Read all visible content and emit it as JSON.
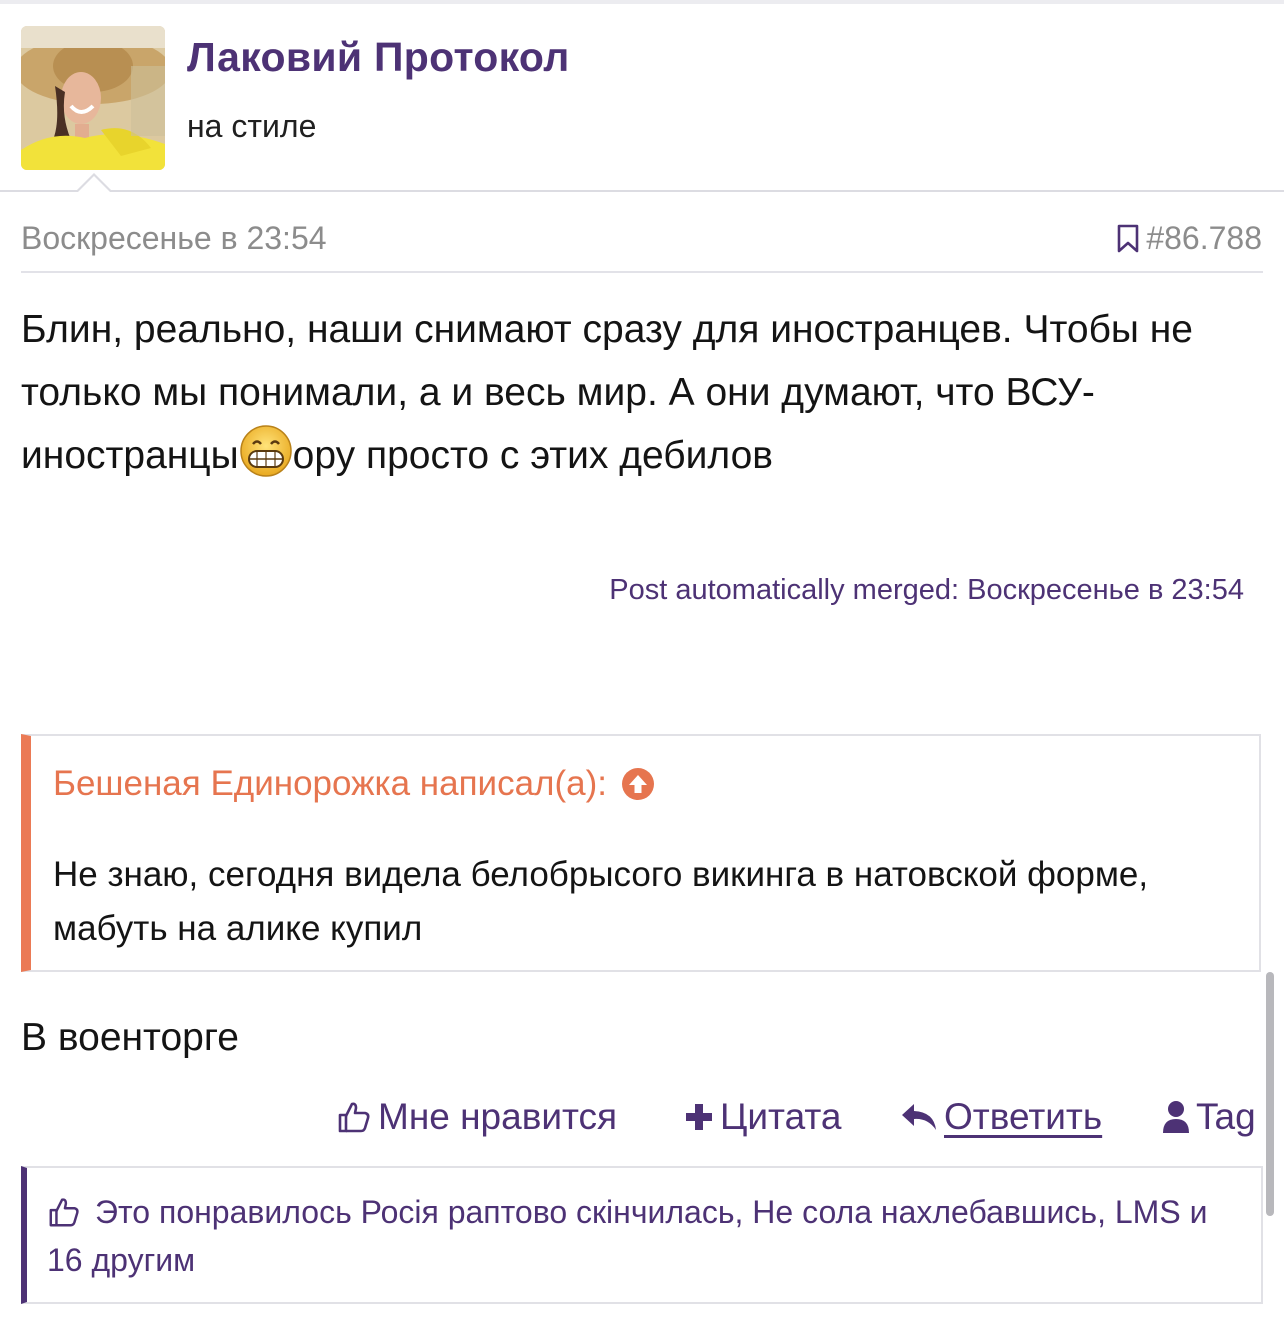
{
  "user": {
    "name": "Лаковий Протокол",
    "title": "на стиле"
  },
  "message": {
    "date": "Воскресенье в 23:54",
    "number": "#86.788",
    "body_part1": "Блин, реально, наши снимают сразу для иностранцев. Чтобы не только мы понимали, а и весь мир. А они думают, что ВСУ-иностранцы",
    "body_part2": "ору просто с этих дебилов",
    "merged_note": "Post automatically merged: Воскресенье в 23:54",
    "reply": "В военторге"
  },
  "quote": {
    "author": "Бешеная Единорожка написал(а):",
    "text": "Не знаю, сегодня видела белобрысого викинга в натовской форме, мабуть на алике купил"
  },
  "actions": {
    "like": "Мне нравится",
    "quote": "Цитата",
    "reply": "Ответить",
    "tag": "Tag"
  },
  "likes": {
    "text": "Это понравилось Росія раптово скінчилась, Не сола нахлебавшись, LMS и 16 другим"
  },
  "colors": {
    "brand": "#4d3275",
    "quote_accent": "#eb7a55",
    "meta_gray": "#8c8c8c"
  },
  "icons": [
    "bookmark-icon",
    "grinning-emoji-icon",
    "arrow-up-circle-icon",
    "thumbs-up-icon",
    "plus-icon",
    "reply-arrow-icon",
    "user-icon"
  ]
}
